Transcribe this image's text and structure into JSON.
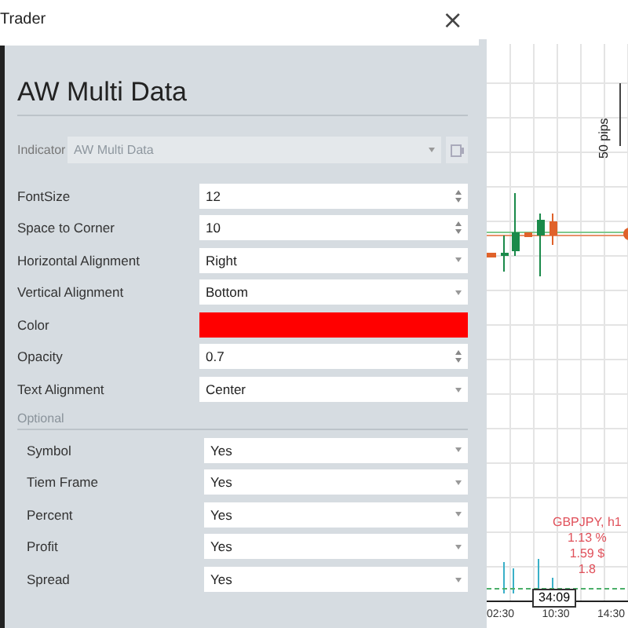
{
  "window": {
    "title": "Trader",
    "close": "×"
  },
  "dialog": {
    "heading": "AW Multi Data",
    "indicator": {
      "label": "Indicator",
      "value": "AW Multi Data",
      "disabled": true
    },
    "fields": [
      {
        "label": "FontSize",
        "value": "12",
        "kind": "number"
      },
      {
        "label": "Space to Corner",
        "value": "10",
        "kind": "number"
      },
      {
        "label": "Horizontal Alignment",
        "value": "Right",
        "kind": "select"
      },
      {
        "label": "Vertical Alignment",
        "value": "Bottom",
        "kind": "select"
      },
      {
        "label": "Color",
        "kind": "color",
        "color": "#ff0000"
      },
      {
        "label": "Opacity",
        "value": "0.7",
        "kind": "number"
      },
      {
        "label": "Text Alignment",
        "value": "Center",
        "kind": "select"
      }
    ],
    "section": "Optional",
    "optional_fields": [
      {
        "label": "Symbol",
        "value": "Yes",
        "kind": "select"
      },
      {
        "label": "Tiem Frame",
        "value": "Yes",
        "kind": "select"
      },
      {
        "label": "Percent",
        "value": "Yes",
        "kind": "select"
      },
      {
        "label": "Profit",
        "value": "Yes",
        "kind": "select"
      },
      {
        "label": "Spread",
        "value": "Yes",
        "kind": "select"
      }
    ]
  },
  "chart": {
    "scale_label": "50 pips",
    "info": [
      "GBPJPY, h1",
      "1.13 %",
      "1.59 $",
      "1.8"
    ],
    "countdown": "34:09",
    "time_labels": [
      "02:30",
      "10:30",
      "14:30"
    ]
  }
}
